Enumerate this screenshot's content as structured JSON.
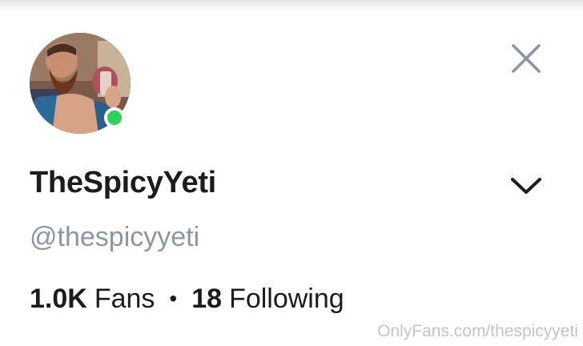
{
  "profile": {
    "display_name": "TheSpicyYeti",
    "username": "@thespicyyeti",
    "online": true,
    "online_color": "#2ecf5b",
    "avatar_icon": "profile-photo"
  },
  "stats": {
    "fans_count": "1.0K",
    "fans_label": "Fans",
    "separator": "•",
    "following_count": "18",
    "following_label": "Following"
  },
  "controls": {
    "close_icon": "close-icon",
    "expand_icon": "chevron-down-icon"
  },
  "watermark": "OnlyFans.com/thespicyyeti",
  "colors": {
    "text": "#1c1c1e",
    "username": "#8a96a3",
    "icon": "#8a96a3",
    "watermark": "#c4c4c4"
  }
}
